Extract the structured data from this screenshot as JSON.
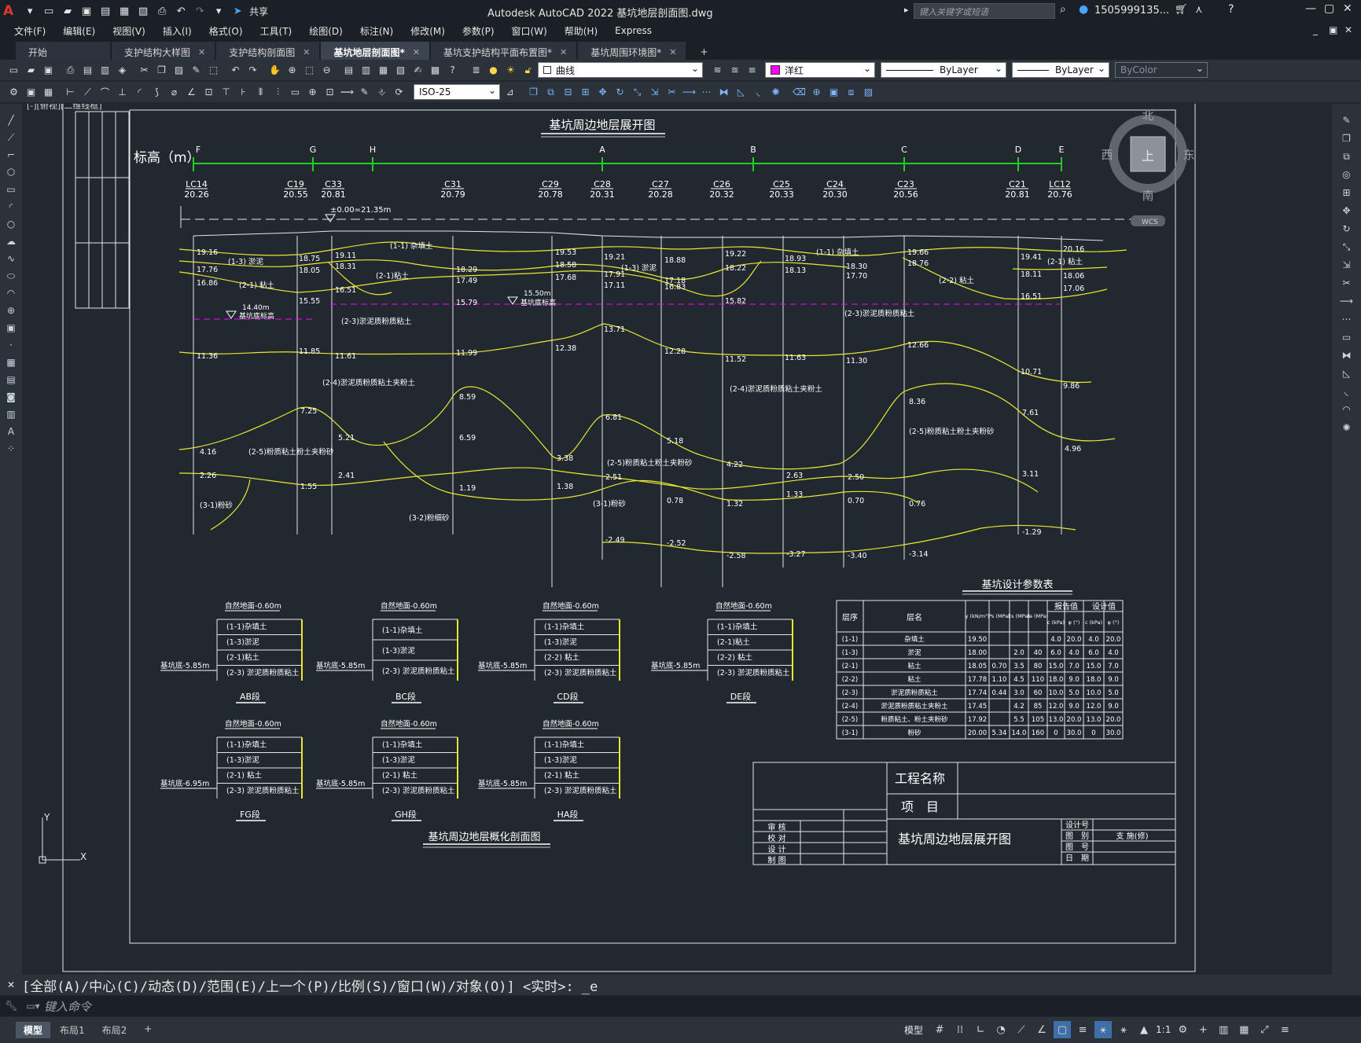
{
  "app": {
    "title": "Autodesk AutoCAD 2022    基坑地层剖面图.dwg",
    "logo": "A",
    "share_label": "共享",
    "search_placeholder": "键入关键字或短语",
    "user": "1505999135...",
    "help": "?"
  },
  "menu": [
    "文件(F)",
    "编辑(E)",
    "视图(V)",
    "插入(I)",
    "格式(O)",
    "工具(T)",
    "绘图(D)",
    "标注(N)",
    "修改(M)",
    "参数(P)",
    "窗口(W)",
    "帮助(H)",
    "Express"
  ],
  "file_tabs": [
    {
      "label": "开始",
      "active": false,
      "closable": false
    },
    {
      "label": "支护结构大样图",
      "active": false,
      "closable": true
    },
    {
      "label": "支护结构剖面图",
      "active": false,
      "closable": true
    },
    {
      "label": "基坑地层剖面图*",
      "active": true,
      "closable": true
    },
    {
      "label": "基坑支护结构平面布置图*",
      "active": false,
      "closable": true
    },
    {
      "label": "基坑周围环境图*",
      "active": false,
      "closable": true
    }
  ],
  "toolbar": {
    "layer_value": "曲线",
    "color_value": "洋红",
    "color_hex": "#ff00ff",
    "linetype_value": "ByLayer",
    "lineweight_value": "ByLayer",
    "plotstyle_value": "ByColor",
    "dimstyle_value": "ISO-25"
  },
  "viewport_label": "[-][俯视][二维线框]",
  "viewcube": {
    "north": "北",
    "south": "南",
    "east": "东",
    "west": "西",
    "top": "上",
    "wcs": "WCS"
  },
  "drawing": {
    "main_title": "基坑周边地层展开图",
    "elevation_label": "标高（m）",
    "section_points": [
      {
        "label": "F"
      },
      {
        "label": "G"
      },
      {
        "label": "H"
      },
      {
        "label": "A"
      },
      {
        "label": "B"
      },
      {
        "label": "C"
      },
      {
        "label": "D"
      },
      {
        "label": "E"
      }
    ],
    "boreholes": [
      {
        "name": "LC14",
        "elev": "20.26"
      },
      {
        "name": "C19",
        "elev": "20.55"
      },
      {
        "name": "C33",
        "elev": "20.81"
      },
      {
        "name": "C31",
        "elev": "20.79"
      },
      {
        "name": "C29",
        "elev": "20.78"
      },
      {
        "name": "C28",
        "elev": "20.31"
      },
      {
        "name": "C27",
        "elev": "20.28"
      },
      {
        "name": "C26",
        "elev": "20.32"
      },
      {
        "name": "C25",
        "elev": "20.33"
      },
      {
        "name": "C24",
        "elev": "20.30"
      },
      {
        "name": "C23",
        "elev": "20.56"
      },
      {
        "name": "C21",
        "elev": "20.81"
      },
      {
        "name": "LC12",
        "elev": "20.76"
      }
    ],
    "datum_label": "±0.00=21.35m",
    "excavation_labels": [
      "基坑底标高",
      "15.50m",
      "基坑底标高",
      "14.40m"
    ],
    "layer_labels": [
      "(1-1) 杂填土",
      "(1-3) 淤泥",
      "(2-1) 粘土",
      "(2-1)粘土",
      "(1-3) 淤泥",
      "(1-1) 杂填土",
      "(2-2) 粘土",
      "(2-1) 粘土",
      "(2-3)淤泥质粉质粘土",
      "(2-3)淤泥质粉质粘土",
      "(2-4)淤泥质粉质粘土夹粉土",
      "(2-4)淤泥质粉质粘土夹粉土",
      "(2-5)粉质粘土粉土夹粉砂",
      "(2-5)粉质粘土粉土夹粉砂",
      "(2-5)粉质粘土粉土夹粉砂",
      "(3-1)粉砂",
      "(3-1)粉砂",
      "(3-2)粉细砂"
    ],
    "depth_values": [
      "19.16",
      "17.76",
      "16.86",
      "18.75",
      "18.05",
      "15.55",
      "19.11",
      "18.31",
      "16.51",
      "18.29",
      "17.49",
      "15.79",
      "19.53",
      "18.58",
      "17.68",
      "19.21",
      "17.91",
      "17.11",
      "18.88",
      "17.18",
      "16.83",
      "19.22",
      "18.22",
      "15.82",
      "18.93",
      "18.13",
      "18.30",
      "17.70",
      "19.66",
      "18.76",
      "19.41",
      "18.11",
      "16.51",
      "20.16",
      "18.06",
      "17.06",
      "11.36",
      "11.85",
      "11.61",
      "11.99",
      "12.38",
      "13.71",
      "12.28",
      "11.52",
      "11.63",
      "11.30",
      "12.66",
      "10.71",
      "9.86",
      "7.25",
      "5.21",
      "8.59",
      "6.59",
      "6.81",
      "5.18",
      "3.38",
      "8.36",
      "7.61",
      "4.96",
      "4.16",
      "2.26",
      "1.55",
      "2.41",
      "1.19",
      "1.38",
      "2.51",
      "0.78",
      "4.22",
      "2.63",
      "2.50",
      "3.11",
      "1.32",
      "1.33",
      "0.70",
      "0.76",
      "-2.49",
      "-2.52",
      "-2.58",
      "-3.27",
      "-3.40",
      "-3.14",
      "-1.29"
    ],
    "profiles_title": "基坑周边地层概化剖面图",
    "profiles": [
      {
        "name": "AB段",
        "ground": "自然地面-0.60m",
        "bottom": "基坑底-5.85m",
        "layers": [
          "(1-1)杂填土",
          "(1-3)淤泥",
          "(2-1)粘土",
          "(2-3) 淤泥质粉质粘土"
        ]
      },
      {
        "name": "BC段",
        "ground": "自然地面-0.60m",
        "bottom": "基坑底-5.85m",
        "layers": [
          "(1-1)杂填土",
          "(1-3)淤泥",
          "(2-3) 淤泥质粉质粘土"
        ]
      },
      {
        "name": "CD段",
        "ground": "自然地面-0.60m",
        "bottom": "基坑底-5.85m",
        "layers": [
          "(1-1)杂填土",
          "(1-3)淤泥",
          "(2-2) 粘土",
          "(2-3) 淤泥质粉质粘土"
        ]
      },
      {
        "name": "DE段",
        "ground": "自然地面-0.60m",
        "bottom": "基坑底-5.85m",
        "layers": [
          "(1-1)杂填土",
          "(2-1)粘土",
          "(2-2) 粘土",
          "(2-3) 淤泥质粉质粘土"
        ]
      },
      {
        "name": "FG段",
        "ground": "自然地面-0.60m",
        "bottom": "基坑底-6.95m",
        "layers": [
          "(1-1)杂填土",
          "(1-3)淤泥",
          "(2-1) 粘土",
          "(2-3) 淤泥质粉质粘土"
        ]
      },
      {
        "name": "GH段",
        "ground": "自然地面-0.60m",
        "bottom": "基坑底-5.85m",
        "layers": [
          "(1-1)杂填土",
          "(1-3)淤泥",
          "(2-1) 粘土",
          "(2-3) 淤泥质粉质粘土"
        ]
      },
      {
        "name": "HA段",
        "ground": "自然地面-0.60m",
        "bottom": "基坑底-5.85m",
        "layers": [
          "(1-1)杂填土",
          "(1-3)淤泥",
          "(2-1) 粘土",
          "(2-3) 淤泥质粉质粘土"
        ]
      }
    ],
    "param_table": {
      "title": "基坑设计参数表",
      "headers": [
        "层序",
        "层名",
        "γ (kN/m³)",
        "Ps (MPa)",
        "Es (MPa)",
        "fa (MPa)",
        "c (kPa)",
        "φ (°)",
        "c (kPa)",
        "φ (°)"
      ],
      "group_headers": [
        "报告值",
        "设计值"
      ],
      "rows": [
        [
          "(1-1)",
          "杂填土",
          "19.50",
          "",
          "",
          "",
          "4.0",
          "20.0",
          "4.0",
          "20.0"
        ],
        [
          "(1-3)",
          "淤泥",
          "18.00",
          "",
          "2.0",
          "40",
          "6.0",
          "4.0",
          "6.0",
          "4.0"
        ],
        [
          "(2-1)",
          "粘土",
          "18.05",
          "0.70",
          "3.5",
          "80",
          "15.0",
          "7.0",
          "15.0",
          "7.0"
        ],
        [
          "(2-2)",
          "粘土",
          "17.78",
          "1.10",
          "4.5",
          "110",
          "18.0",
          "9.0",
          "18.0",
          "9.0"
        ],
        [
          "(2-3)",
          "淤泥质粉质粘土",
          "17.74",
          "0.44",
          "3.0",
          "60",
          "10.0",
          "5.0",
          "10.0",
          "5.0"
        ],
        [
          "(2-4)",
          "淤泥质粉质粘土夹粉土",
          "17.45",
          "",
          "4.2",
          "85",
          "12.0",
          "9.0",
          "12.0",
          "9.0"
        ],
        [
          "(2-5)",
          "粉质粘土、粉土夹粉砂",
          "17.92",
          "",
          "5.5",
          "105",
          "13.0",
          "20.0",
          "13.0",
          "20.0"
        ],
        [
          "(3-1)",
          "粉砂",
          "20.00",
          "5.34",
          "14.0",
          "160",
          "0",
          "30.0",
          "0",
          "30.0"
        ]
      ]
    },
    "title_block": {
      "project_name_label": "工程名称",
      "item_label": "项　目",
      "drawing_name": "基坑周边地层展开图",
      "sign_rows": [
        "审 核",
        "校 对",
        "设 计",
        "制 图"
      ],
      "info_rows": [
        "设计号",
        "图　别",
        "图　号",
        "日　期"
      ],
      "category_value": "支 施(修)"
    }
  },
  "command": {
    "history": "[全部(A)/中心(C)/动态(D)/范围(E)/上一个(P)/比例(S)/窗口(W)/对象(O)] <实时>: _e",
    "input_placeholder": "键入命令"
  },
  "status": {
    "layout_tabs": [
      "模型",
      "布局1",
      "布局2"
    ],
    "model_label": "模型",
    "scale": "1:1"
  }
}
